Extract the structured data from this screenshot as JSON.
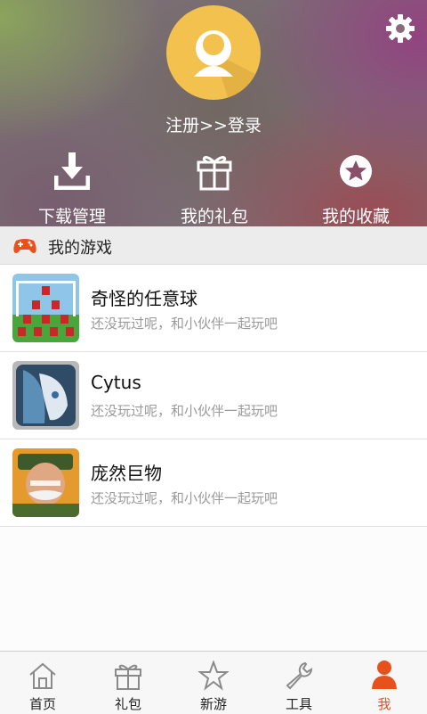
{
  "header": {
    "login_text": "注册>>登录"
  },
  "quick_actions": [
    {
      "label": "下载管理",
      "icon": "download-icon"
    },
    {
      "label": "我的礼包",
      "icon": "gift-icon"
    },
    {
      "label": "我的收藏",
      "icon": "star-badge-icon"
    }
  ],
  "section": {
    "title": "我的游戏",
    "icon": "gamepad-icon"
  },
  "games": [
    {
      "name": "奇怪的任意球",
      "desc": "还没玩过呢，和小伙伴一起玩吧"
    },
    {
      "name": "Cytus",
      "desc": "还没玩过呢，和小伙伴一起玩吧"
    },
    {
      "name": "庞然巨物",
      "desc": "还没玩过呢，和小伙伴一起玩吧"
    }
  ],
  "tabs": [
    {
      "label": "首页",
      "icon": "home-icon"
    },
    {
      "label": "礼包",
      "icon": "gift-icon"
    },
    {
      "label": "新游",
      "icon": "star-icon"
    },
    {
      "label": "工具",
      "icon": "wrench-icon"
    },
    {
      "label": "我",
      "icon": "person-icon",
      "active": true
    }
  ],
  "colors": {
    "accent": "#e8501c",
    "avatar_bg": "#f2c14e"
  }
}
